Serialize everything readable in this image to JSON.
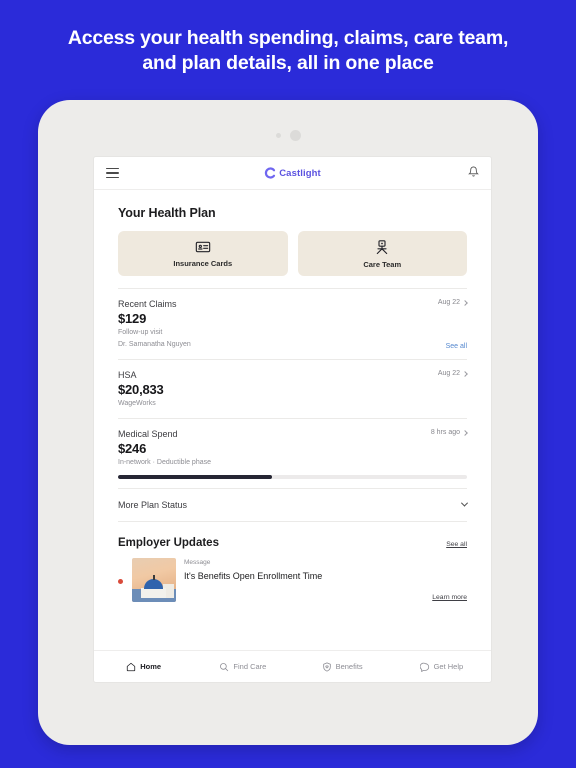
{
  "promo": {
    "line1": "Access your health spending, claims, care team,",
    "line2": "and plan details, all in one place"
  },
  "app": {
    "brand_name": "Castlight",
    "menu_icon": "hamburger-menu-icon",
    "notification_icon": "bell-icon"
  },
  "main": {
    "section_title": "Your Health Plan",
    "tiles": [
      {
        "label": "Insurance Cards",
        "icon": "id-card-icon"
      },
      {
        "label": "Care Team",
        "icon": "doctor-person-icon"
      }
    ],
    "rows": [
      {
        "title": "Recent Claims",
        "meta": "Aug 22",
        "amount": "$129",
        "sub1": "Follow-up visit",
        "sub2": "Dr. Samanatha Nguyen",
        "action": "See all"
      },
      {
        "title": "HSA",
        "meta": "Aug 22",
        "amount": "$20,833",
        "sub1": "WageWorks"
      },
      {
        "title": "Medical Spend",
        "meta": "8 hrs ago",
        "amount": "$246",
        "sub1": "In-network · Deductible phase",
        "progress_percent": 44
      }
    ],
    "accordion": {
      "label": "More Plan Status",
      "icon": "chevron-down-icon"
    },
    "employer_updates": {
      "title": "Employer Updates",
      "see_all": "See all",
      "item": {
        "kind": "Message",
        "headline": "It's Benefits Open Enrollment Time",
        "cta": "Learn more",
        "thumbnail": "santorini-blue-dome-church-photo",
        "unread": true
      }
    }
  },
  "bottom_nav": [
    {
      "label": "Home",
      "icon": "home-icon",
      "active": true
    },
    {
      "label": "Find Care",
      "icon": "search-magnifier-icon",
      "active": false
    },
    {
      "label": "Benefits",
      "icon": "shield-heart-icon",
      "active": false
    },
    {
      "label": "Get Help",
      "icon": "chat-bubble-icon",
      "active": false
    }
  ],
  "colors": {
    "background_blue": "#2b2bd9",
    "brand_purple": "#5b52e0",
    "tile_beige": "#efe9de",
    "link_blue": "#5588cf",
    "progress_dark": "#262634",
    "unread_red": "#d94a3a"
  }
}
